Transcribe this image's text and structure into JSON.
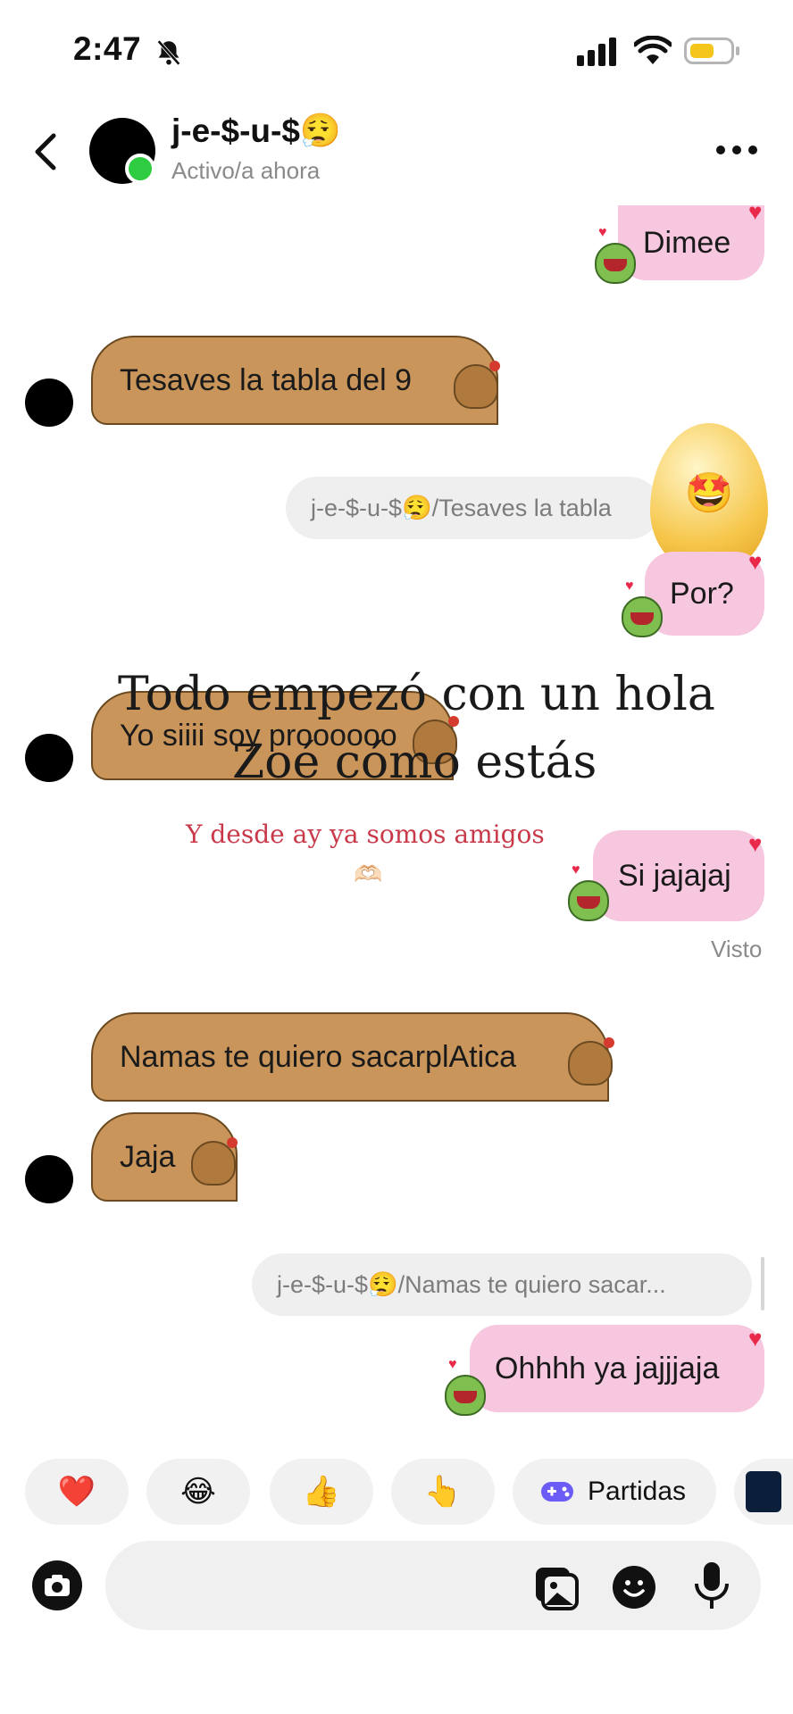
{
  "status_bar": {
    "time": "2:47",
    "battery_color": "#f4c51a"
  },
  "header": {
    "contact_name": "j-e-$-u-$😮‍💨",
    "contact_status": "Activo/a ahora",
    "online_color": "#2ecc40"
  },
  "messages": {
    "m1_out": "Dimee",
    "m2_in": "Tesaves la tabla del 9",
    "m3_reply_preview": "j-e-$-u-$😮‍💨/Tesaves la tabla",
    "m3_out": "Por?",
    "m4_in": "Yo siiii soy proooooo",
    "m5_out": "Si jajajaj",
    "seen_label": "Visto",
    "m6_in": "Namas te quiero sacarplAtica",
    "m7_in": "Jaja",
    "m8_reply_preview": "j-e-$-u-$😮‍💨/Namas te quiero sacar...",
    "m8_out": "Ohhhh ya jajjjaja"
  },
  "overlay": {
    "line1": "Todo empezó con un hola",
    "line2": "Zoé cómo estás",
    "line3": "Y desde ay ya somos amigos",
    "line4_emoji": "🫶🏻",
    "egg_emoji": "🤩"
  },
  "quick_reactions": {
    "heart": "❤️",
    "laugh": "😂",
    "thumbs": "👍",
    "point": "👆",
    "games_label": "Partidas"
  },
  "colors": {
    "bubble_in": "#c9955a",
    "bubble_out": "#f7c6df",
    "accent_red": "#e8294a"
  }
}
